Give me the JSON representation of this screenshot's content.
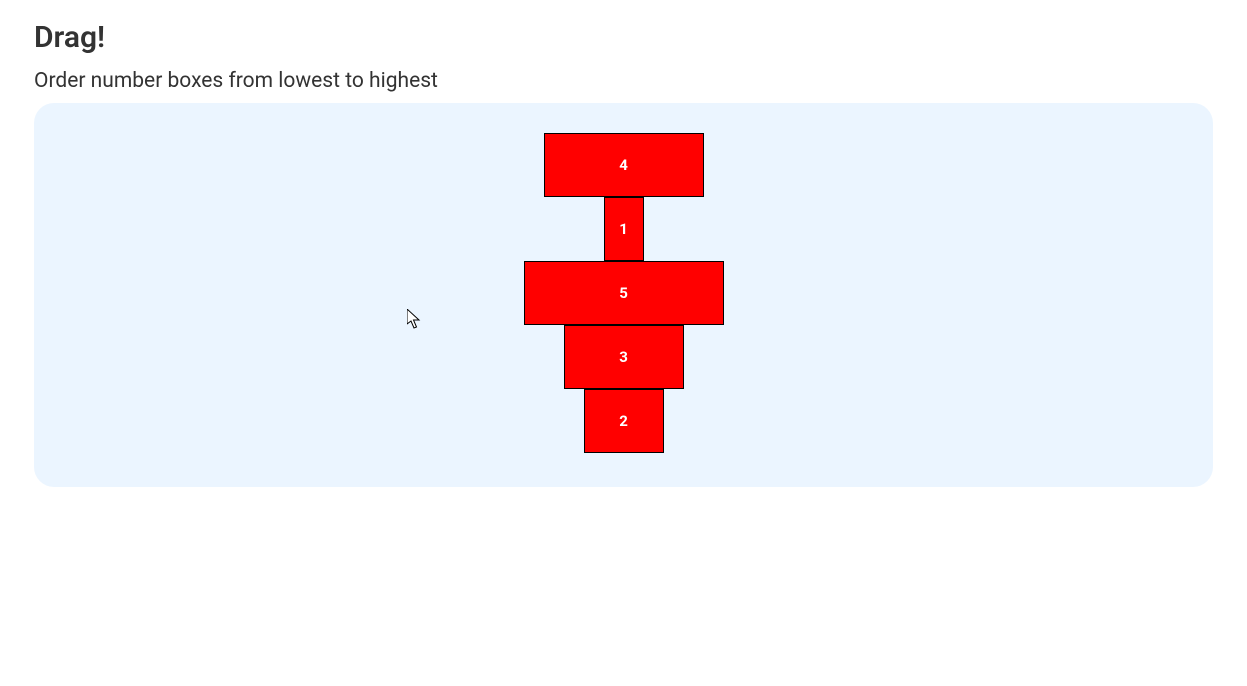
{
  "title": "Drag!",
  "instructions": "Order number boxes from lowest to highest",
  "boxes": [
    {
      "label": "4"
    },
    {
      "label": "1"
    },
    {
      "label": "5"
    },
    {
      "label": "3"
    },
    {
      "label": "2"
    }
  ]
}
